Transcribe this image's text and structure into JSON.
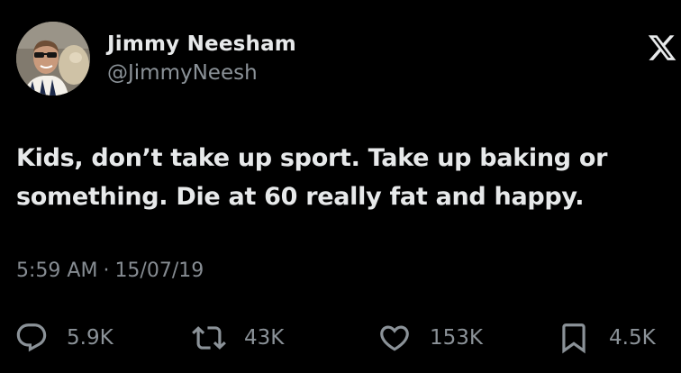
{
  "author": {
    "display_name": "Jimmy Neesham",
    "handle": "@JimmyNeesh"
  },
  "brand": {
    "icon": "x-logo-icon"
  },
  "tweet": {
    "text": "Kids, don’t take up sport. Take up baking or something. Die at 60 really fat and happy.",
    "time": "5:59 AM",
    "separator": "·",
    "date": "15/07/19"
  },
  "actions": {
    "replies": {
      "icon": "reply-icon",
      "count": "5.9K"
    },
    "retweets": {
      "icon": "retweet-icon",
      "count": "43K"
    },
    "likes": {
      "icon": "heart-icon",
      "count": "153K"
    },
    "bookmarks": {
      "icon": "bookmark-icon",
      "count": "4.5K"
    }
  },
  "colors": {
    "background": "#000000",
    "text": "#e7e9ea",
    "secondary_text": "#8b9298"
  }
}
